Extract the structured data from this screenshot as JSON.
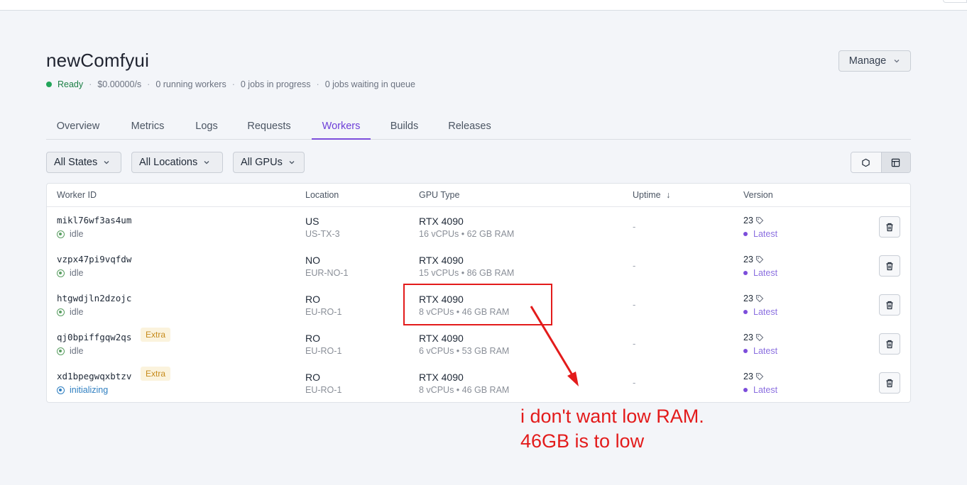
{
  "header": {
    "title": "newComfyui",
    "status": "Ready",
    "cost": "$0.00000/s",
    "running_workers": "0 running workers",
    "jobs_in_progress": "0 jobs in progress",
    "jobs_waiting": "0 jobs waiting in queue",
    "manage_label": "Manage"
  },
  "tabs": [
    "Overview",
    "Metrics",
    "Logs",
    "Requests",
    "Workers",
    "Builds",
    "Releases"
  ],
  "active_tab": "Workers",
  "filters": {
    "states": "All States",
    "locations": "All Locations",
    "gpus": "All GPUs"
  },
  "view_toggle": {
    "icons": [
      "hexagon-icon",
      "table-icon"
    ],
    "active": "table-icon"
  },
  "table": {
    "columns": {
      "worker_id": "Worker ID",
      "location": "Location",
      "gpu_type": "GPU Type",
      "uptime": "Uptime",
      "uptime_sort": "↓",
      "version": "Version"
    },
    "rows": [
      {
        "id": "mikl76wf3as4um",
        "state": "idle",
        "extra": "",
        "location": "US",
        "region": "US-TX-3",
        "gpu": "RTX 4090",
        "specs": "16 vCPUs • 62 GB RAM",
        "uptime": "-",
        "version": "23",
        "tag": "Latest"
      },
      {
        "id": "vzpx47pi9vqfdw",
        "state": "idle",
        "extra": "",
        "location": "NO",
        "region": "EUR-NO-1",
        "gpu": "RTX 4090",
        "specs": "15 vCPUs • 86 GB RAM",
        "uptime": "-",
        "version": "23",
        "tag": "Latest"
      },
      {
        "id": "htgwdjln2dzojc",
        "state": "idle",
        "extra": "",
        "location": "RO",
        "region": "EU-RO-1",
        "gpu": "RTX 4090",
        "specs": "8 vCPUs • 46 GB RAM",
        "uptime": "-",
        "version": "23",
        "tag": "Latest"
      },
      {
        "id": "qj0bpiffgqw2qs",
        "state": "idle",
        "extra": "Extra",
        "location": "RO",
        "region": "EU-RO-1",
        "gpu": "RTX 4090",
        "specs": "6 vCPUs • 53 GB RAM",
        "uptime": "-",
        "version": "23",
        "tag": "Latest"
      },
      {
        "id": "xd1bpegwqxbtzv",
        "state": "initializing",
        "extra": "Extra",
        "location": "RO",
        "region": "EU-RO-1",
        "gpu": "RTX 4090",
        "specs": "8 vCPUs • 46 GB RAM",
        "uptime": "-",
        "version": "23",
        "tag": "Latest"
      }
    ]
  },
  "annotation": {
    "line1": "i don't want low RAM.",
    "line2": "46GB is to low",
    "color": "#e31b1b"
  },
  "colors": {
    "accent": "#7c4ddb",
    "ready": "#22a55a",
    "extra_badge": "#c68a1a"
  }
}
